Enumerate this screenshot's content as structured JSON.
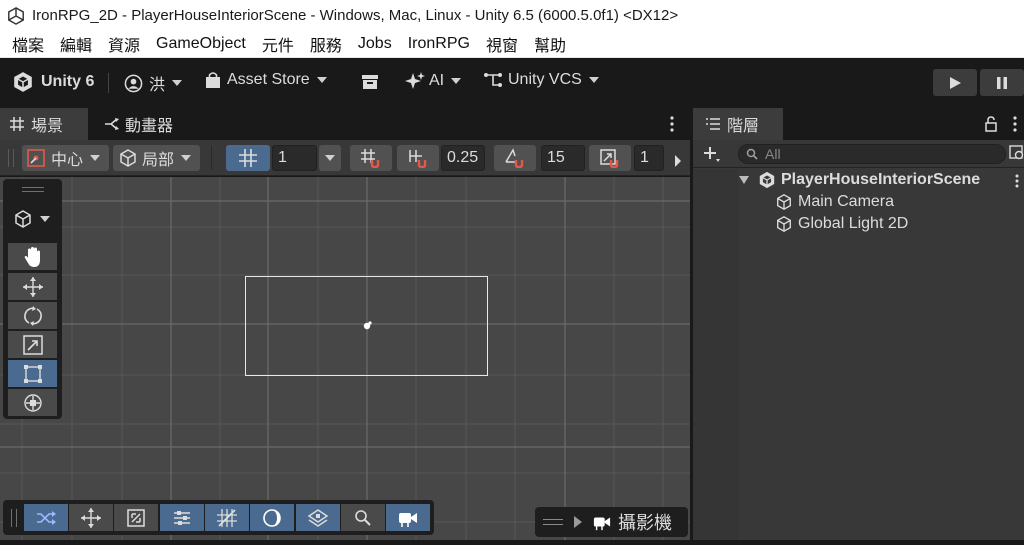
{
  "window": {
    "title": "IronRPG_2D - PlayerHouseInteriorScene - Windows, Mac, Linux - Unity 6.5 (6000.5.0f1) <DX12>"
  },
  "menu": {
    "items": [
      "檔案",
      "編輯",
      "資源",
      "GameObject",
      "元件",
      "服務",
      "Jobs",
      "IronRPG",
      "視窗",
      "幫助"
    ]
  },
  "toolbar": {
    "unity_label": "Unity 6",
    "account_label": "洪",
    "asset_store_label": "Asset Store",
    "ai_label": "AI",
    "vcs_label": "Unity VCS"
  },
  "scene_panel": {
    "tabs": [
      {
        "label": "場景",
        "icon": "grid-icon",
        "active": true
      },
      {
        "label": "動畫器",
        "icon": "animator-icon",
        "active": false
      }
    ],
    "pivot_label": "中心",
    "local_label": "局部",
    "grid_size": "1",
    "snap_increment": "0.25",
    "rotation_snap": "15",
    "scale_snap": "1",
    "camera_label": "攝影機"
  },
  "hierarchy": {
    "tab_label": "階層",
    "search_placeholder": "All",
    "scene_name": "PlayerHouseInteriorScene",
    "objects": [
      "Main Camera",
      "Global Light 2D"
    ]
  }
}
